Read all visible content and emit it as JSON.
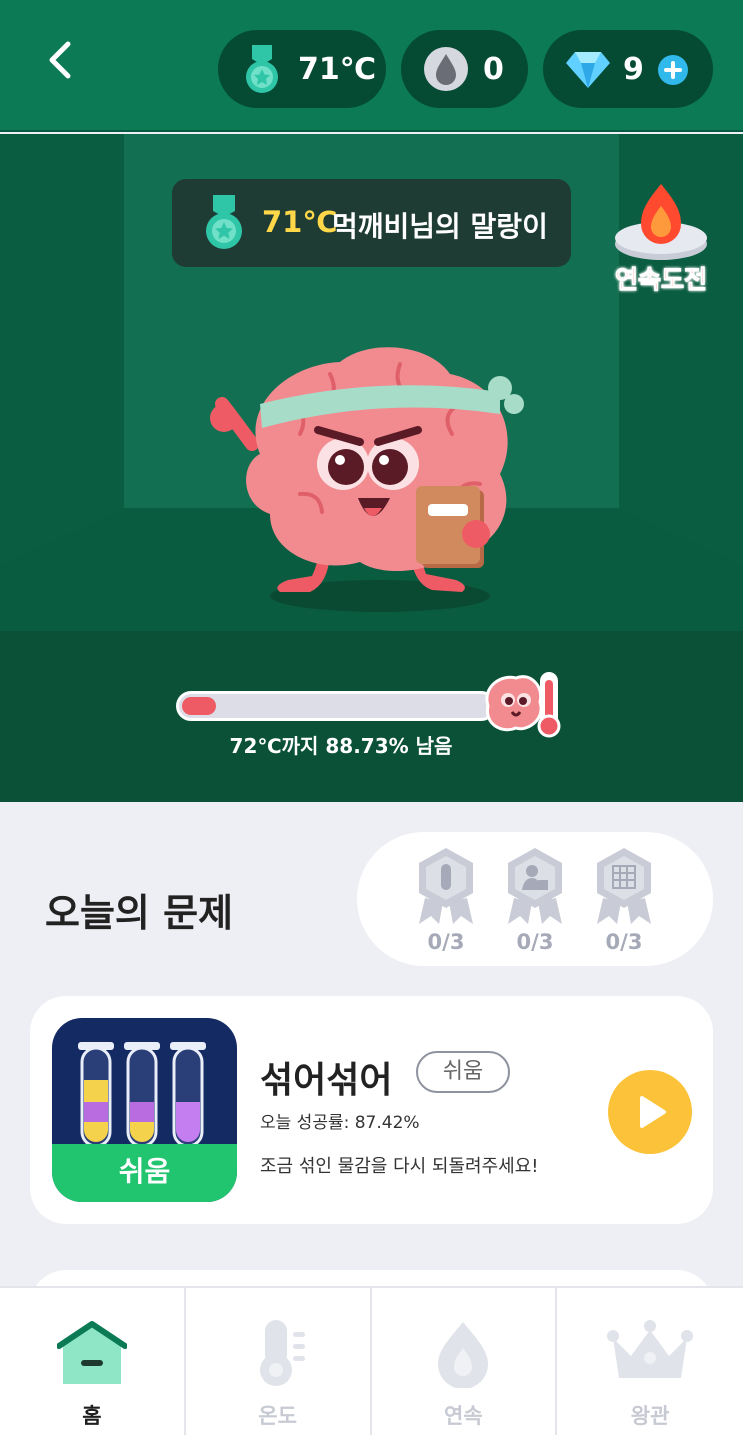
{
  "header": {
    "temperature": "71℃",
    "drops": "0",
    "gems": "9"
  },
  "room": {
    "banner_temp": "71℃",
    "banner_name": "먹깨비님의 말랑이",
    "streak_challenge": "연속도전",
    "progress_fraction": 0.11,
    "progress_label": "72℃까지 88.73% 남음"
  },
  "today": {
    "title": "오늘의 문제",
    "badges": [
      "0/3",
      "0/3",
      "0/3"
    ]
  },
  "puzzle": {
    "thumb_label": "쉬움",
    "name": "섞어섞어",
    "difficulty": "쉬움",
    "success_rate": "오늘 성공률: 87.42%",
    "description": "조금 섞인 물감을 다시 되돌려주세요!"
  },
  "nav": {
    "items": [
      {
        "label": "홈",
        "icon": "home-icon",
        "active": true
      },
      {
        "label": "온도",
        "icon": "thermometer-icon",
        "active": false
      },
      {
        "label": "연속",
        "icon": "flame-icon",
        "active": false
      },
      {
        "label": "왕관",
        "icon": "crown-icon",
        "active": false
      }
    ]
  },
  "colors": {
    "header_green": "#0b7a55",
    "room_green": "#0e6a4c",
    "accent_yellow": "#ffd84a",
    "play_yellow": "#fcc23a",
    "easy_green": "#21c46f",
    "streak_red": "#ff3b2f"
  }
}
